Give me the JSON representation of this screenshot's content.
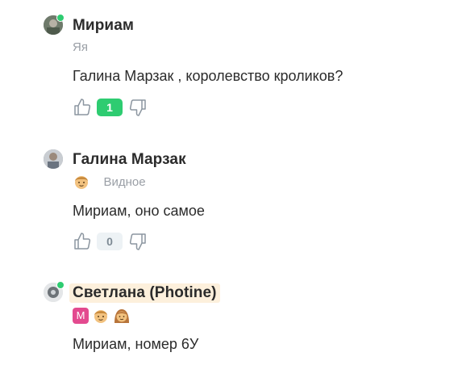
{
  "comments": [
    {
      "author": "Мириам",
      "subtitle": "Яя",
      "text": "Галина Марзак , королевство кроликов?",
      "likes": "1",
      "online": true
    },
    {
      "author": "Галина Марзак",
      "location": "Видное",
      "text": "Мириам, оно самое",
      "likes": "0",
      "online": false
    },
    {
      "author": "Светлана (Photine)",
      "badge_letter": "М",
      "text": "Мириам, номер 6У",
      "online": true
    }
  ],
  "colors": {
    "online": "#2ecc71",
    "positive_votes": "#2ecc71",
    "zero_votes_bg": "#edf2f5",
    "highlight_name_bg": "#fdf0dc",
    "badge_m": "#e34a8f"
  },
  "icons": [
    "thumbs-up-icon",
    "thumbs-down-icon",
    "boy-face-emoji",
    "girl-face-emoji"
  ]
}
